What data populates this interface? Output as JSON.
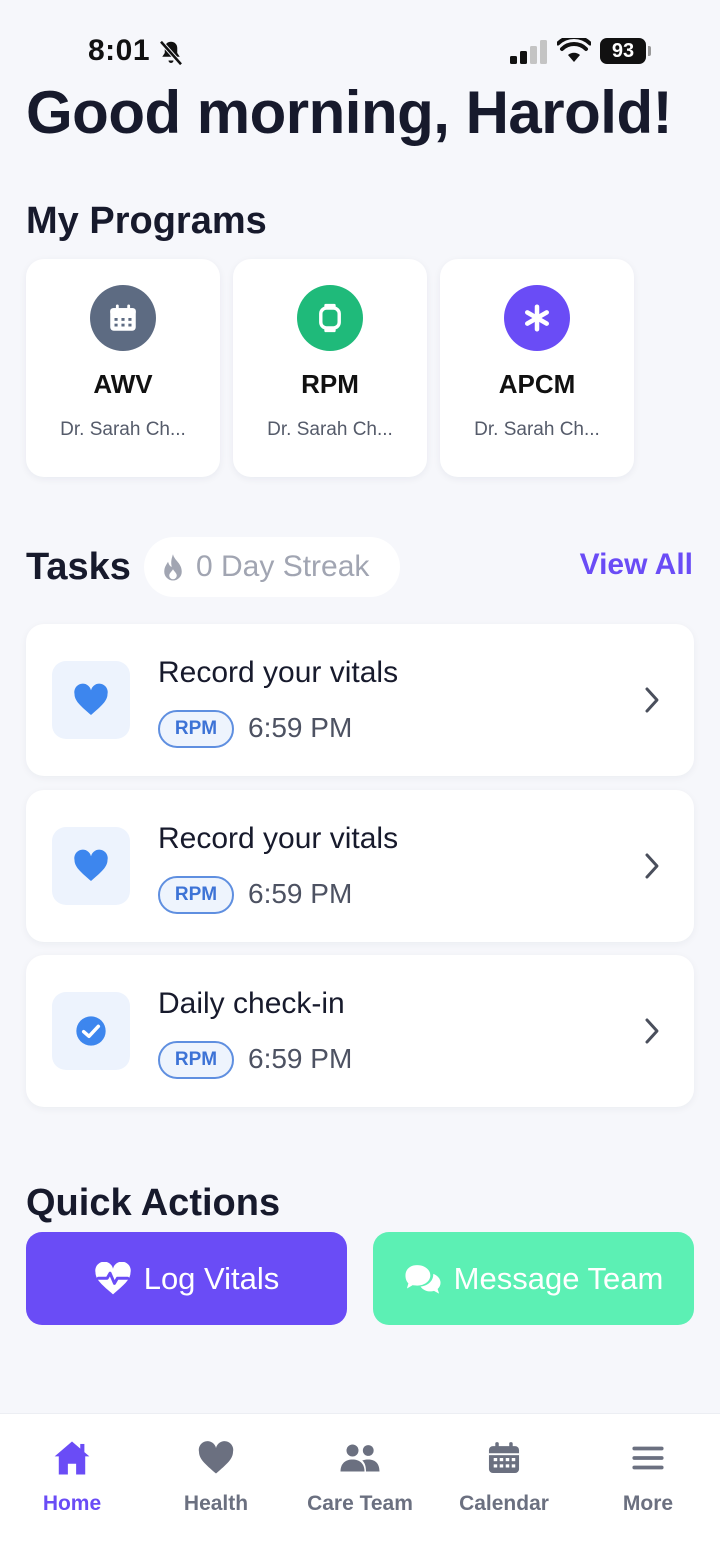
{
  "status_bar": {
    "time": "8:01",
    "battery": "93"
  },
  "greeting": "Good morning, Harold!",
  "programs": {
    "title": "My Programs",
    "items": [
      {
        "name": "AWV",
        "doctor": "Dr. Sarah Ch...",
        "icon": "calendar-icon",
        "color": "#5d6b82"
      },
      {
        "name": "RPM",
        "doctor": "Dr. Sarah Ch...",
        "icon": "watch-icon",
        "color": "#1fba7a"
      },
      {
        "name": "APCM",
        "doctor": "Dr. Sarah Ch...",
        "icon": "asterisk-icon",
        "color": "#6a4cf6"
      }
    ]
  },
  "tasks": {
    "title": "Tasks",
    "streak": "0 Day Streak",
    "view_all": "View All",
    "items": [
      {
        "title": "Record your vitals",
        "badge": "RPM",
        "time": "6:59 PM",
        "icon": "heart-icon"
      },
      {
        "title": "Record your vitals",
        "badge": "RPM",
        "time": "6:59 PM",
        "icon": "heart-icon"
      },
      {
        "title": "Daily check-in",
        "badge": "RPM",
        "time": "6:59 PM",
        "icon": "check-circle-icon"
      }
    ]
  },
  "quick_actions": {
    "title": "Quick Actions",
    "log_vitals": "Log Vitals",
    "message_team": "Message Team"
  },
  "nav": {
    "active": "Home",
    "items": [
      {
        "label": "Home",
        "icon": "home-icon"
      },
      {
        "label": "Health",
        "icon": "heart-icon"
      },
      {
        "label": "Care Team",
        "icon": "people-icon"
      },
      {
        "label": "Calendar",
        "icon": "calendar-icon"
      },
      {
        "label": "More",
        "icon": "menu-icon"
      }
    ]
  },
  "colors": {
    "accent": "#6a4cf6",
    "green": "#5cf0b4",
    "task_blue": "#3d73d6"
  }
}
